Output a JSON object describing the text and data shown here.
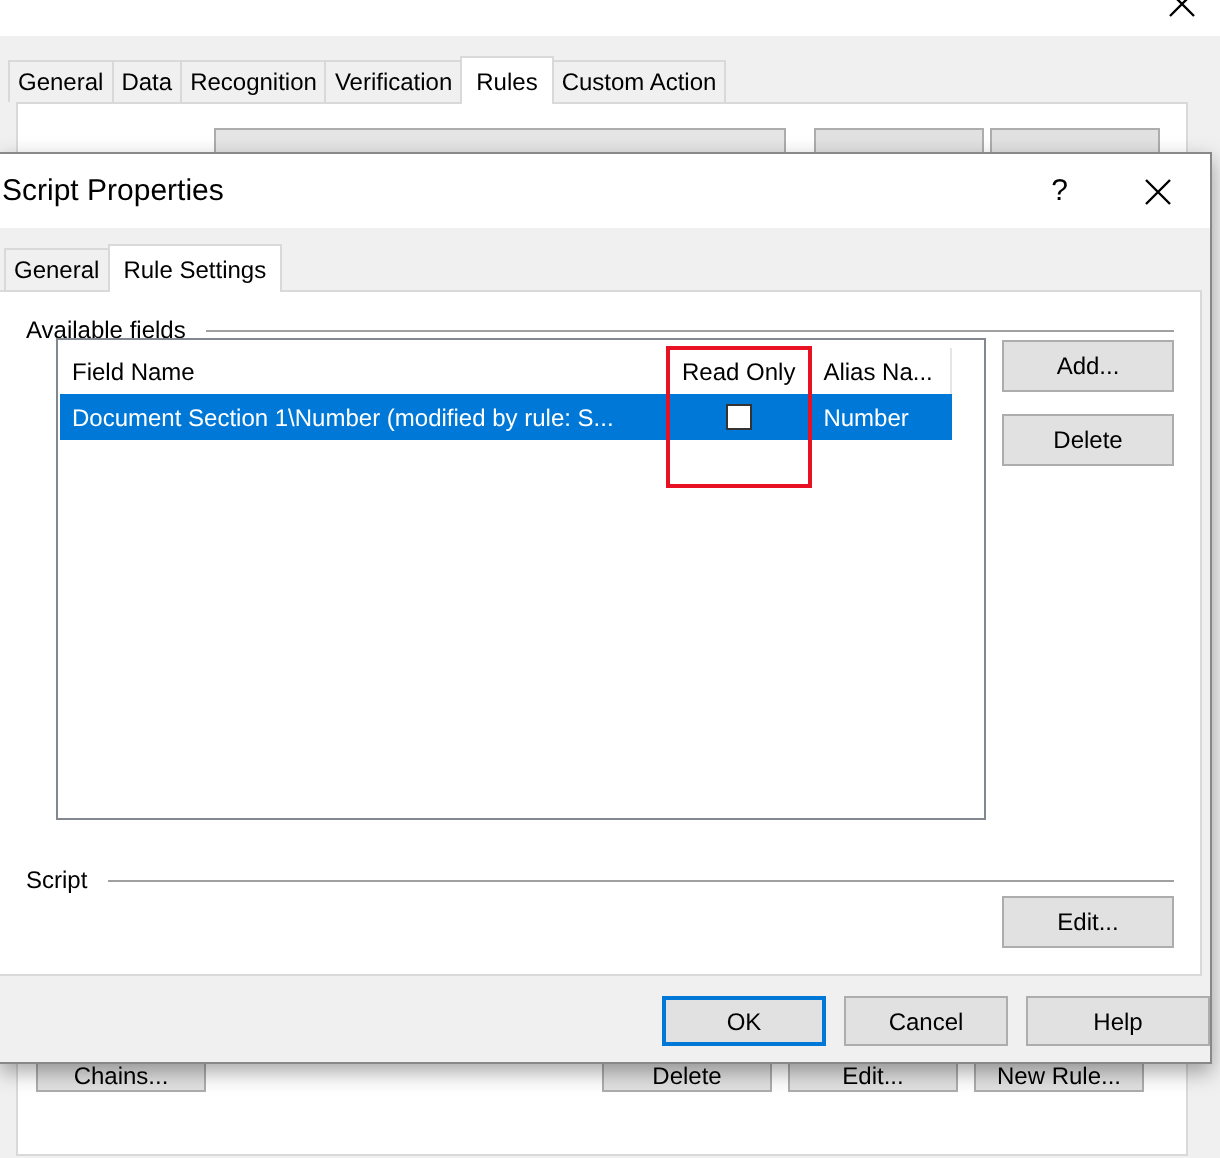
{
  "background_window": {
    "tabs": [
      {
        "label": "General",
        "selected": false
      },
      {
        "label": "Data",
        "selected": false
      },
      {
        "label": "Recognition",
        "selected": false
      },
      {
        "label": "Verification",
        "selected": false
      },
      {
        "label": "Rules",
        "selected": true
      },
      {
        "label": "Custom Action",
        "selected": false
      }
    ],
    "bottom_left_button": "Chains...",
    "bottom_buttons": [
      "Delete",
      "Edit...",
      "New Rule..."
    ]
  },
  "dialog": {
    "title": "Script Properties",
    "help": "?",
    "tabs": [
      {
        "label": "General",
        "selected": false
      },
      {
        "label": "Rule Settings",
        "selected": true
      }
    ],
    "fields_group": {
      "label": "Available fields",
      "columns": [
        {
          "label": "Field Name",
          "highlighted": false
        },
        {
          "label": "Read Only",
          "highlighted": true
        },
        {
          "label": "Alias Na...",
          "highlighted": false
        }
      ],
      "rows": [
        {
          "field_name": "Document Section 1\\Number (modified by rule: S...",
          "read_only": false,
          "alias": "Number",
          "selected": true
        }
      ],
      "buttons": [
        "Add...",
        "Delete"
      ]
    },
    "script_group": {
      "label": "Script",
      "button": "Edit..."
    },
    "buttons": [
      {
        "label": "OK",
        "default": true
      },
      {
        "label": "Cancel",
        "default": false
      },
      {
        "label": "Help",
        "default": false
      }
    ]
  }
}
